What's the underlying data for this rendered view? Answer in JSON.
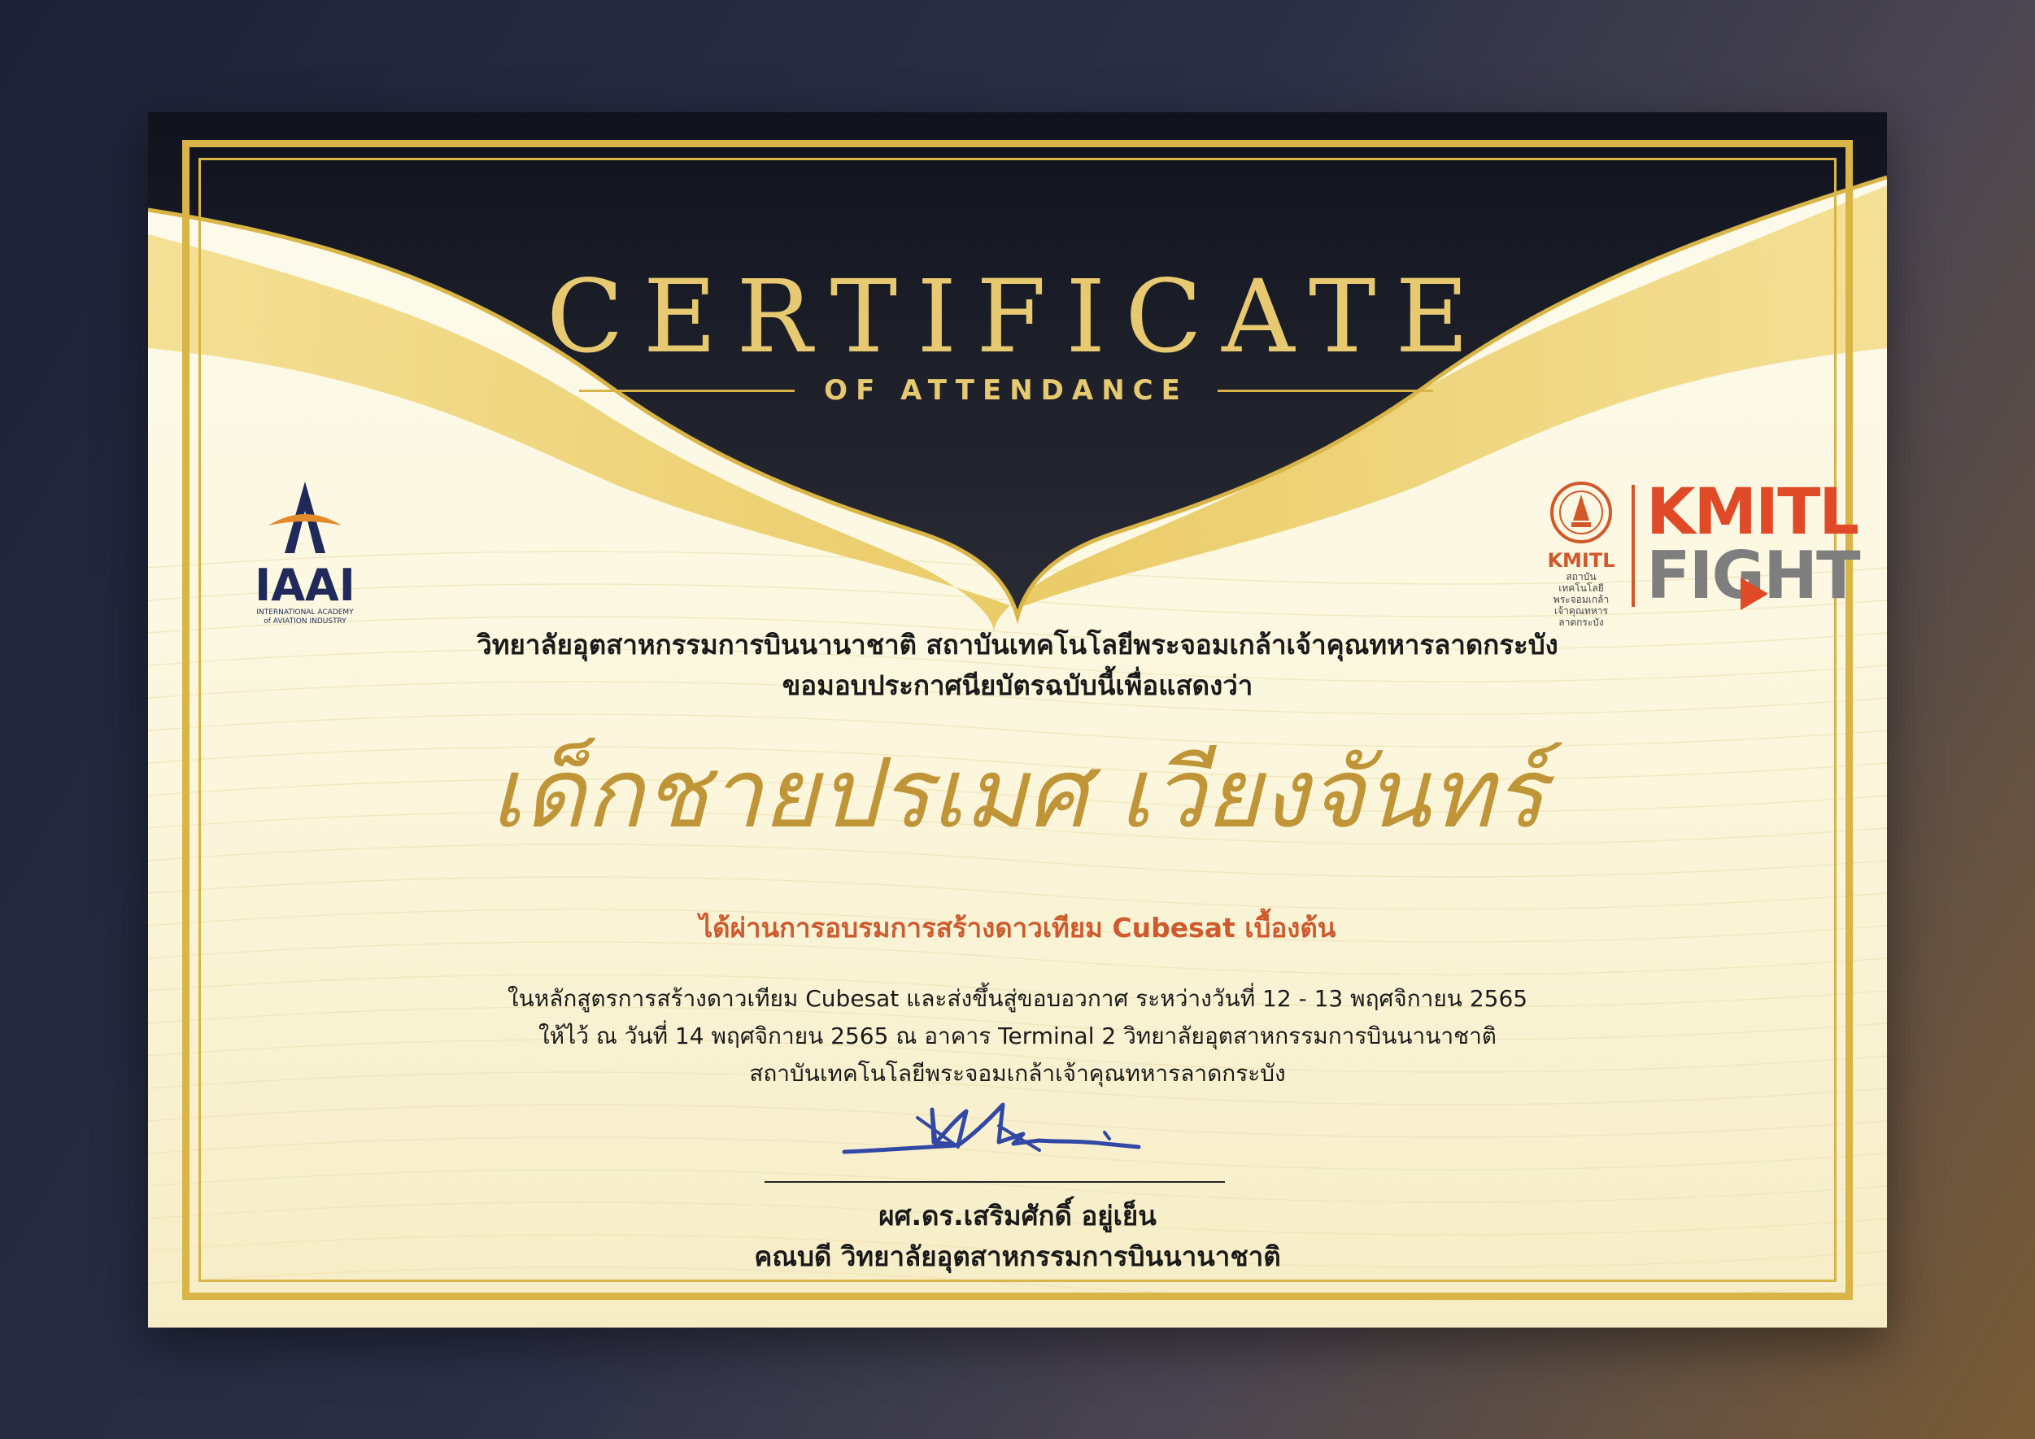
{
  "certificate": {
    "title": "CERTIFICATE",
    "subtitle": "OF ATTENDANCE",
    "intro_line1": "วิทยาลัยอุตสาหกรรมการบินนานาชาติ สถาบันเทคโนโลยีพระจอมเกล้าเจ้าคุณทหารลาดกระบัง",
    "intro_line2": "ขอมอบประกาศนียบัตรฉบับนี้เพื่อแสดงว่า",
    "recipient_name": "เด็กชายปรเมศ เวียงจันทร์",
    "achievement": "ได้ผ่านการอบรมการสร้างดาวเทียม Cubesat เบื้องต้น",
    "detail_line1": "ในหลักสูตรการสร้างดาวเทียม Cubesat และส่งขึ้นสู่ขอบอวกาศ ระหว่างวันที่ 12 - 13 พฤศจิกายน 2565",
    "detail_line2": "ให้ไว้ ณ วันที่ 14 พฤศจิกายน 2565 ณ อาคาร Terminal 2 วิทยาลัยอุตสาหกรรมการบินนานาชาติ",
    "detail_line3": "สถาบันเทคโนโลยีพระจอมเกล้าเจ้าคุณทหารลาดกระบัง",
    "signer_name": "ผศ.ดร.เสริมศักดิ์ อยู่เย็น",
    "signer_title": "คณบดี วิทยาลัยอุตสาหกรรมการบินนานาชาติ"
  },
  "logos": {
    "iaai_text": "IAAI",
    "iaai_small_1": "INTERNATIONAL ACADEMY",
    "iaai_small_2": "of AVIATION INDUSTRY",
    "kmitl_seal_text": "KMITL",
    "kmitl_seal_small_1": "สถาบันเทคโนโลยี",
    "kmitl_seal_small_2": "พระจอมเกล้า",
    "kmitl_seal_small_3": "เจ้าคุณทหารลาดกระบัง",
    "kmitl_fight_1": "KMITL",
    "kmitl_fight_2": "FIGHT"
  },
  "colors": {
    "gold": "#d9b447",
    "navy": "#151824",
    "recipient": "#bf9538",
    "accent_orange": "#cf5a2d",
    "iaai_blue": "#1f2a5a"
  }
}
